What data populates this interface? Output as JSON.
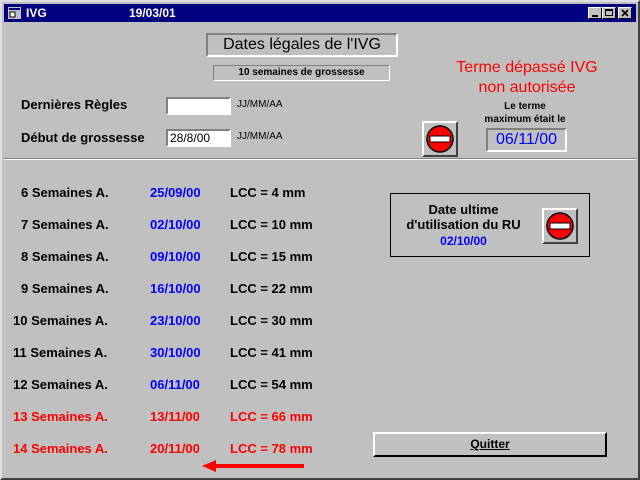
{
  "window": {
    "title": "IVG",
    "date": "19/03/01"
  },
  "header": {
    "heading": "Dates légales de l'IVG",
    "weeks_summary": "10 semaines de grossesse"
  },
  "form": {
    "last_period_label": "Dernières Règles",
    "last_period_value": "",
    "last_period_format": "JJ/MM/AA",
    "pregnancy_start_label": "Début de grossesse",
    "pregnancy_start_value": "28/8/00",
    "pregnancy_start_format": "JJ/MM/AA"
  },
  "warning": {
    "line1": "Terme dépassé IVG",
    "line2": "non autorisée",
    "max_label_line1": "Le terme",
    "max_label_line2": "maximum était le",
    "max_date": "06/11/00"
  },
  "weeks": [
    {
      "label": "6 Semaines A.",
      "date": "25/09/00",
      "lcc": "LCC = 4 mm",
      "overdue": false
    },
    {
      "label": "7 Semaines A.",
      "date": "02/10/00",
      "lcc": "LCC = 10 mm",
      "overdue": false
    },
    {
      "label": "8 Semaines A.",
      "date": "09/10/00",
      "lcc": "LCC = 15 mm",
      "overdue": false
    },
    {
      "label": "9 Semaines A.",
      "date": "16/10/00",
      "lcc": "LCC = 22 mm",
      "overdue": false
    },
    {
      "label": "10 Semaines A.",
      "date": "23/10/00",
      "lcc": "LCC = 30 mm",
      "overdue": false
    },
    {
      "label": "11 Semaines A.",
      "date": "30/10/00",
      "lcc": "LCC = 41 mm",
      "overdue": false
    },
    {
      "label": "12 Semaines A.",
      "date": "06/11/00",
      "lcc": "LCC = 54 mm",
      "overdue": false
    },
    {
      "label": "13 Semaines A.",
      "date": "13/11/00",
      "lcc": "LCC = 66 mm",
      "overdue": true
    },
    {
      "label": "14 Semaines A.",
      "date": "20/11/00",
      "lcc": "LCC = 78 mm",
      "overdue": true
    }
  ],
  "ru": {
    "line1": "Date ultime",
    "line2": "d'utilisation du RU",
    "date": "02/10/00"
  },
  "buttons": {
    "quit_label": "Quitter"
  },
  "colors": {
    "titlebar": "#000080",
    "face": "#c0c0c0",
    "warning": "#ff0000",
    "date_blue": "#0000ff"
  }
}
